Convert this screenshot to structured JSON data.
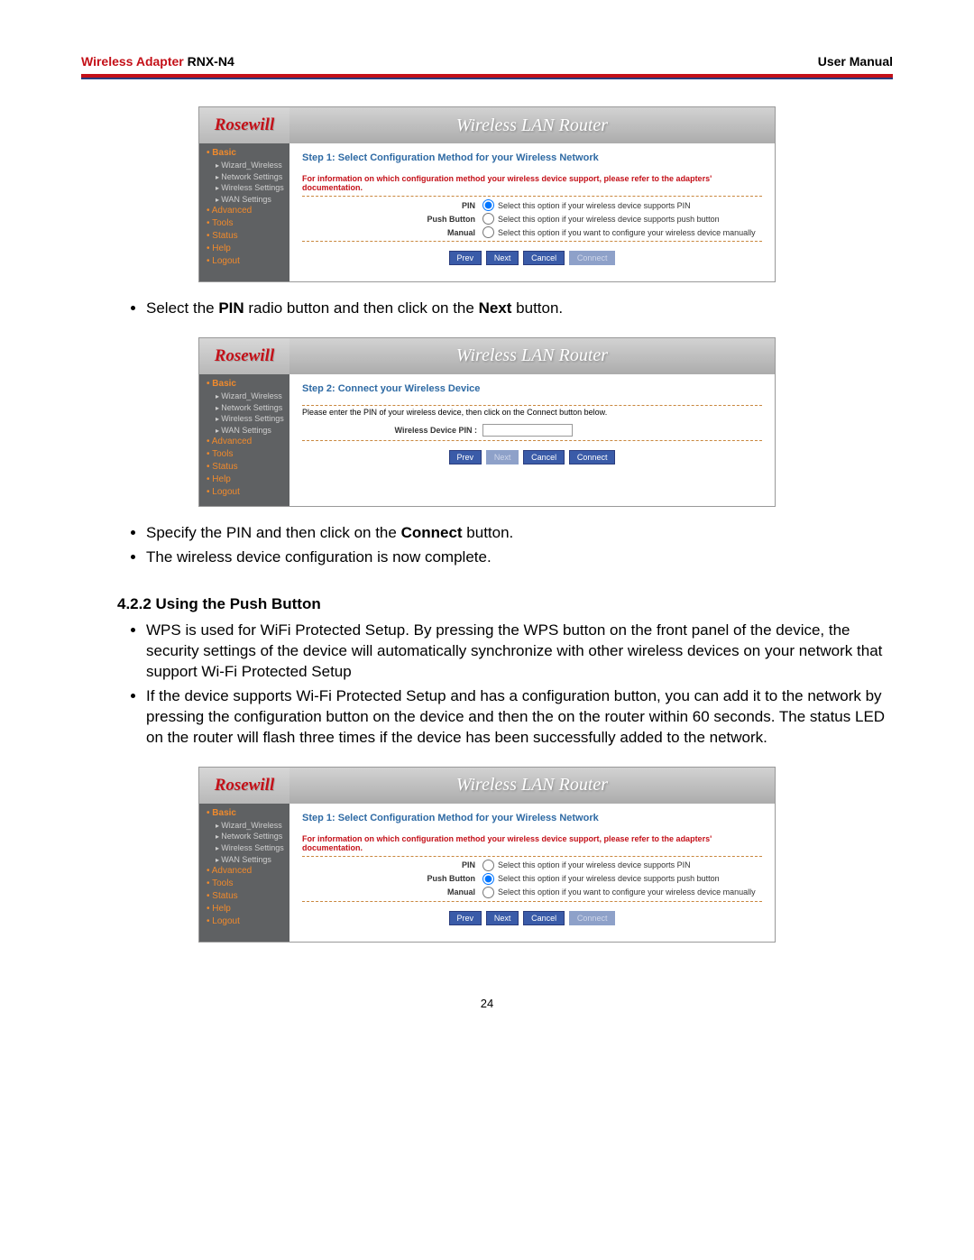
{
  "doc_header": {
    "wireless_adapter": "Wireless Adapter",
    "model": "RNX-N4",
    "user_manual": "User Manual"
  },
  "router": {
    "logo_text": "Rosewill",
    "title": "Wireless LAN Router",
    "sidebar": {
      "basic": "Basic",
      "wizard": "Wizard_Wireless",
      "network": "Network Settings",
      "wireless": "Wireless Settings",
      "wan": "WAN Settings",
      "advanced": "Advanced",
      "tools": "Tools",
      "status": "Status",
      "help": "Help",
      "logout": "Logout"
    }
  },
  "shot1": {
    "step_title": "Step 1: Select Configuration Method for your Wireless Network",
    "red_note": "For information on which configuration method your wireless device support, please refer to the adapters' documentation.",
    "rows": [
      {
        "label": "PIN",
        "selected": true,
        "desc": "Select this option if your wireless device supports PIN"
      },
      {
        "label": "Push Button",
        "selected": false,
        "desc": "Select this option if your wireless device supports push button"
      },
      {
        "label": "Manual",
        "selected": false,
        "desc": "Select this option if you want to configure your wireless device manually"
      }
    ],
    "buttons": {
      "prev": "Prev",
      "next": "Next",
      "cancel": "Cancel",
      "connect": "Connect"
    },
    "connect_disabled": true
  },
  "bullets1": {
    "text_pre": "Select the ",
    "pin_bold": "PIN",
    "text_mid": " radio button and then click on the ",
    "next_bold": "Next",
    "text_end": " button."
  },
  "shot2": {
    "step_title": "Step 2: Connect your Wireless Device",
    "instr": "Please enter the PIN of your wireless device, then click on the Connect button below.",
    "pin_label": "Wireless Device PIN :",
    "pin_value": "",
    "buttons": {
      "prev": "Prev",
      "next": "Next",
      "cancel": "Cancel",
      "connect": "Connect"
    },
    "next_disabled": true
  },
  "bullets2": [
    {
      "pre": "Specify the PIN and then click on the ",
      "bold": "Connect",
      "post": " button."
    },
    {
      "full": "The wireless device configuration is now complete."
    }
  ],
  "section_422": "4.2.2  Using the Push Button",
  "bullets3": [
    "WPS is used for WiFi Protected Setup. By pressing the WPS button on the front panel of the device, the security settings of the device will automatically synchronize with other wireless devices on your network that support Wi-Fi Protected Setup",
    "If the device supports Wi-Fi Protected Setup and has a configuration button, you can add it to the network by pressing the configuration button on the device and then the on the router within 60 seconds. The status LED on the router will flash three times if the device has been successfully added to the network."
  ],
  "shot3": {
    "step_title": "Step 1: Select Configuration Method for your Wireless Network",
    "red_note": "For information on which configuration method your wireless device support, please refer to the adapters' documentation.",
    "rows": [
      {
        "label": "PIN",
        "selected": false,
        "desc": "Select this option if your wireless device supports PIN"
      },
      {
        "label": "Push Button",
        "selected": true,
        "desc": "Select this option if your wireless device supports push button"
      },
      {
        "label": "Manual",
        "selected": false,
        "desc": "Select this option if you want to configure your wireless device manually"
      }
    ],
    "buttons": {
      "prev": "Prev",
      "next": "Next",
      "cancel": "Cancel",
      "connect": "Connect"
    },
    "connect_disabled": true
  },
  "page_number": "24"
}
